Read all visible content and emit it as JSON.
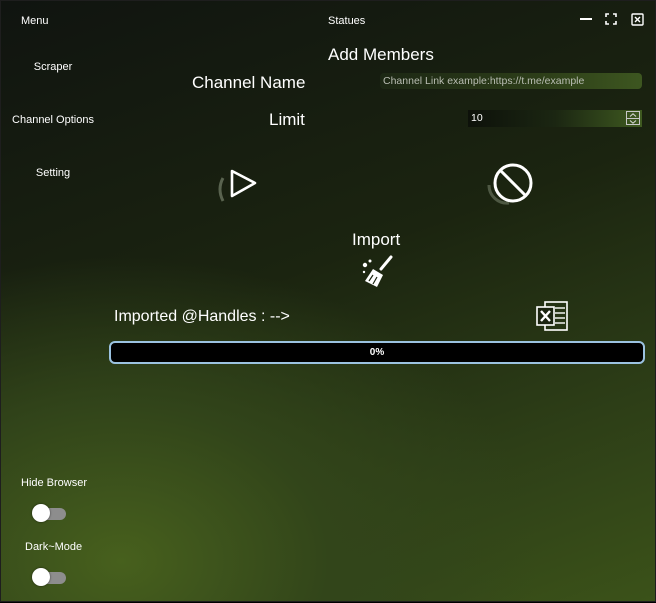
{
  "sidebar": {
    "title": "Menu",
    "items": [
      {
        "label": "Scraper"
      },
      {
        "label": "Channel Options"
      },
      {
        "label": "Setting"
      }
    ],
    "toggles": [
      {
        "label": "Hide Browser",
        "on": false
      },
      {
        "label": "Dark~Mode",
        "on": false
      }
    ]
  },
  "header": {
    "title": "Statues",
    "controls": [
      "minimize-icon",
      "maximize-icon",
      "close-icon"
    ]
  },
  "main": {
    "heading": "Add Members",
    "channel_label": "Channel Name",
    "channel_placeholder": "Channel Link example:https://t.me/example",
    "limit_label": "Limit",
    "limit_value": "10",
    "start_icon": "play-icon",
    "stop_icon": "stop-icon",
    "import_label": "Import",
    "import_icon": "broom-icon",
    "imported_label": "Imported @Handles : -->",
    "excel_icon": "excel-icon",
    "progress_text": "0%",
    "progress_value": 0
  }
}
